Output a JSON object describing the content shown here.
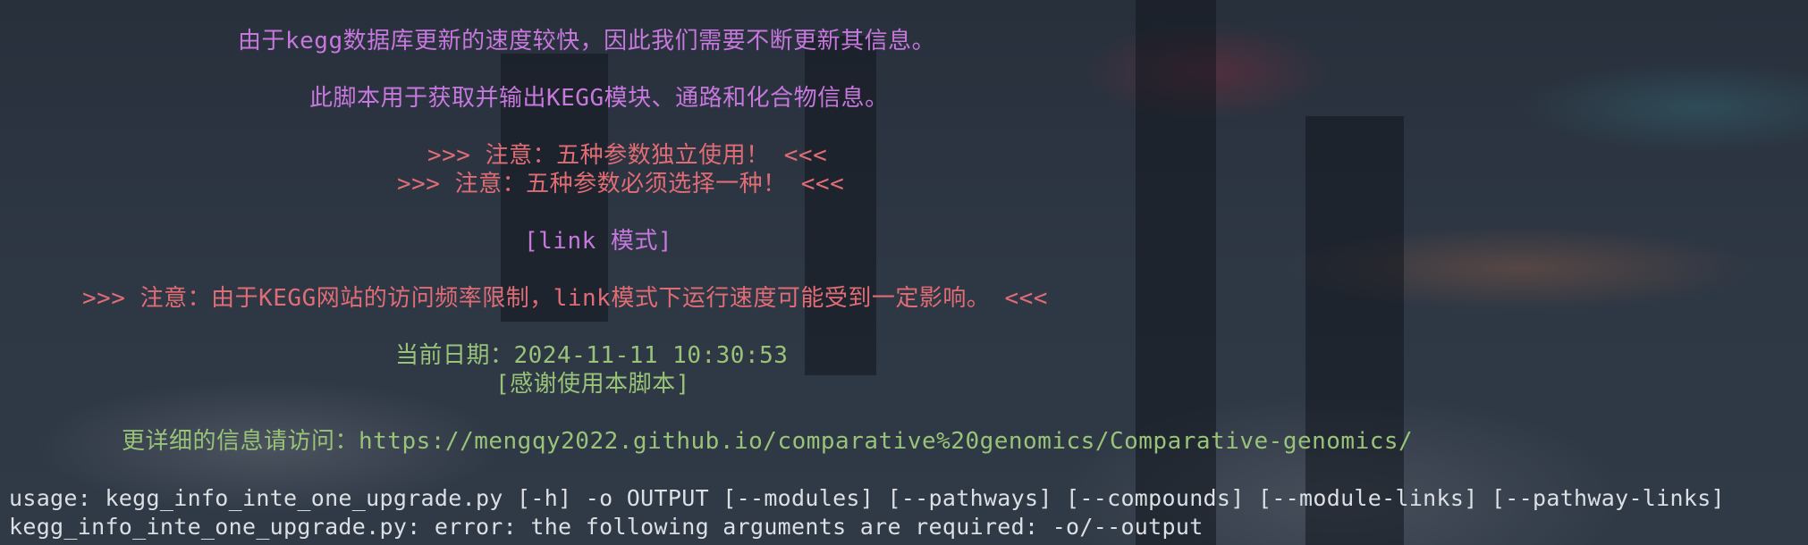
{
  "terminal": {
    "lines": {
      "intro_update": "由于kegg数据库更新的速度较快，因此我们需要不断更新其信息。",
      "intro_purpose": "此脚本用于获取并输出KEGG模块、通路和化合物信息。",
      "note_independent": ">>> 注意：五种参数独立使用！ <<<",
      "note_required": ">>> 注意：五种参数必须选择一种！ <<<",
      "link_mode": "[link 模式]",
      "note_rate_limit": ">>> 注意：由于KEGG网站的访问频率限制，link模式下运行速度可能受到一定影响。 <<<",
      "current_date": "当前日期：2024-11-11 10:30:53",
      "thanks": "[感谢使用本脚本]",
      "more_info": "更详细的信息请访问：https://mengqy2022.github.io/comparative%20genomics/Comparative-genomics/",
      "usage": "usage: kegg_info_inte_one_upgrade.py [-h] -o OUTPUT [--modules] [--pathways] [--compounds] [--module-links] [--pathway-links]",
      "error": "kegg_info_inte_one_upgrade.py: error: the following arguments are required: -o/--output"
    },
    "colors": {
      "magenta": "#c678dd",
      "red": "#e06c75",
      "green": "#98c379",
      "white": "#dcdfe4"
    }
  }
}
